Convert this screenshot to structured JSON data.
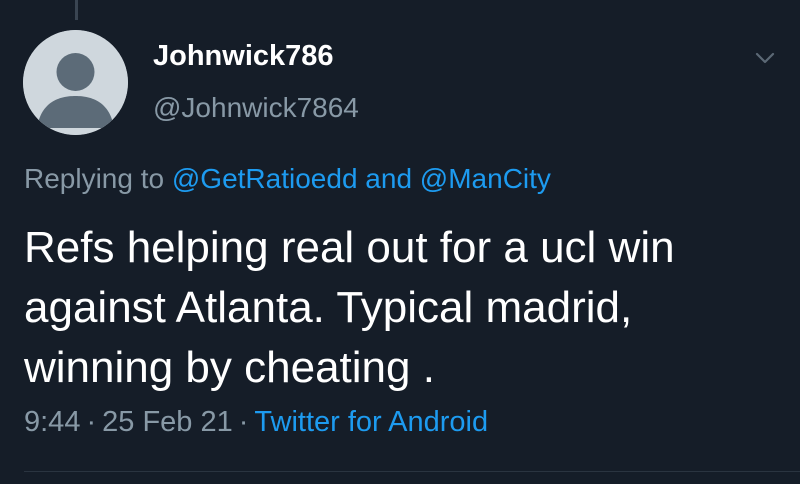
{
  "tweet": {
    "author": {
      "display_name": "Johnwick786",
      "handle": "@Johnwick7864"
    },
    "replying_to": {
      "prefix": "Replying to",
      "mention_1": "@GetRatioedd",
      "conjunction": "and",
      "mention_2": "@ManCity"
    },
    "text_lines": [
      "Refs helping real out for a ucl win",
      "against Atlanta. Typical madrid,",
      "winning by cheating ."
    ],
    "time": "9:44",
    "date": "25 Feb 21",
    "separator": "·",
    "source": "Twitter for Android",
    "icons": {
      "avatar": "default-avatar-icon",
      "menu": "chevron-down-icon"
    }
  },
  "colors": {
    "background": "#151d28",
    "secondary_text": "#8899a6",
    "link": "#1d9bf0"
  }
}
